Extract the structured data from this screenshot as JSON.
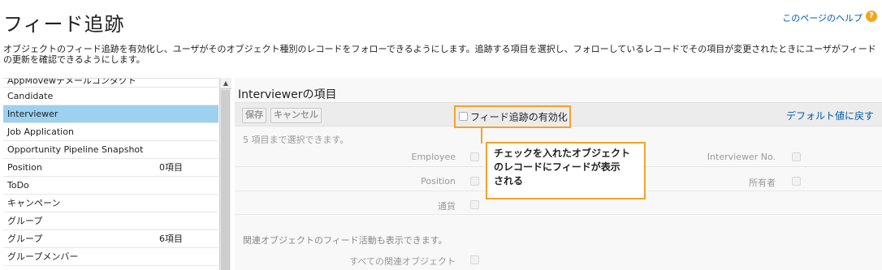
{
  "page": {
    "title": "フィード追跡",
    "help_link": "このページのヘルプ",
    "help_icon": "help-icon",
    "description": "オブジェクトのフィード追跡を有効化し、ユーザがそのオブジェクト種別のレコードをフォローできるようにします。追跡する項目を選択し、フォローしているレコードでその項目が変更されたときにユーザがフィードの更新を確認できるようにします。"
  },
  "object_list": {
    "items": [
      {
        "label": "AppMovewデメールコンタクト",
        "count": "",
        "selected": false,
        "clipped": true
      },
      {
        "label": "Candidate",
        "count": "",
        "selected": false
      },
      {
        "label": "Interviewer",
        "count": "",
        "selected": true
      },
      {
        "label": "Job Application",
        "count": "",
        "selected": false
      },
      {
        "label": "Opportunity Pipeline Snapshot",
        "count": "",
        "selected": false
      },
      {
        "label": "Position",
        "count": "0項目",
        "selected": false
      },
      {
        "label": "ToDo",
        "count": "",
        "selected": false
      },
      {
        "label": "キャンペーン",
        "count": "",
        "selected": false
      },
      {
        "label": "グループ",
        "count": "",
        "selected": false
      },
      {
        "label": "グループ",
        "count": "6項目",
        "selected": false
      },
      {
        "label": "グループメンバー",
        "count": "",
        "selected": false
      }
    ]
  },
  "detail": {
    "section_title": "Interviewerの項目",
    "toolbar": {
      "save_label": "保存",
      "cancel_label": "キャンセル",
      "enable_feed_label": "フィード追跡の有効化",
      "enable_feed_checked": false,
      "default_link": "デフォルト値に戻す"
    },
    "select_hint": "5 項目まで選択できます。",
    "fields": [
      {
        "left": "Employee",
        "right": "Interviewer No."
      },
      {
        "left": "Position",
        "right": "所有者"
      },
      {
        "left": "通貨",
        "right": ""
      }
    ],
    "related_hint": "関連オブジェクトのフィード活動も表示できます。",
    "related_label": "すべての関連オブジェクト"
  },
  "callout": {
    "line1": "チェックを入れたオブジェクト",
    "line2": "のレコードにフィードが表示",
    "line3": "される"
  },
  "colors": {
    "selected_row": "#9dd1f0",
    "callout_border": "#f3a32b",
    "link": "#015ba7"
  }
}
